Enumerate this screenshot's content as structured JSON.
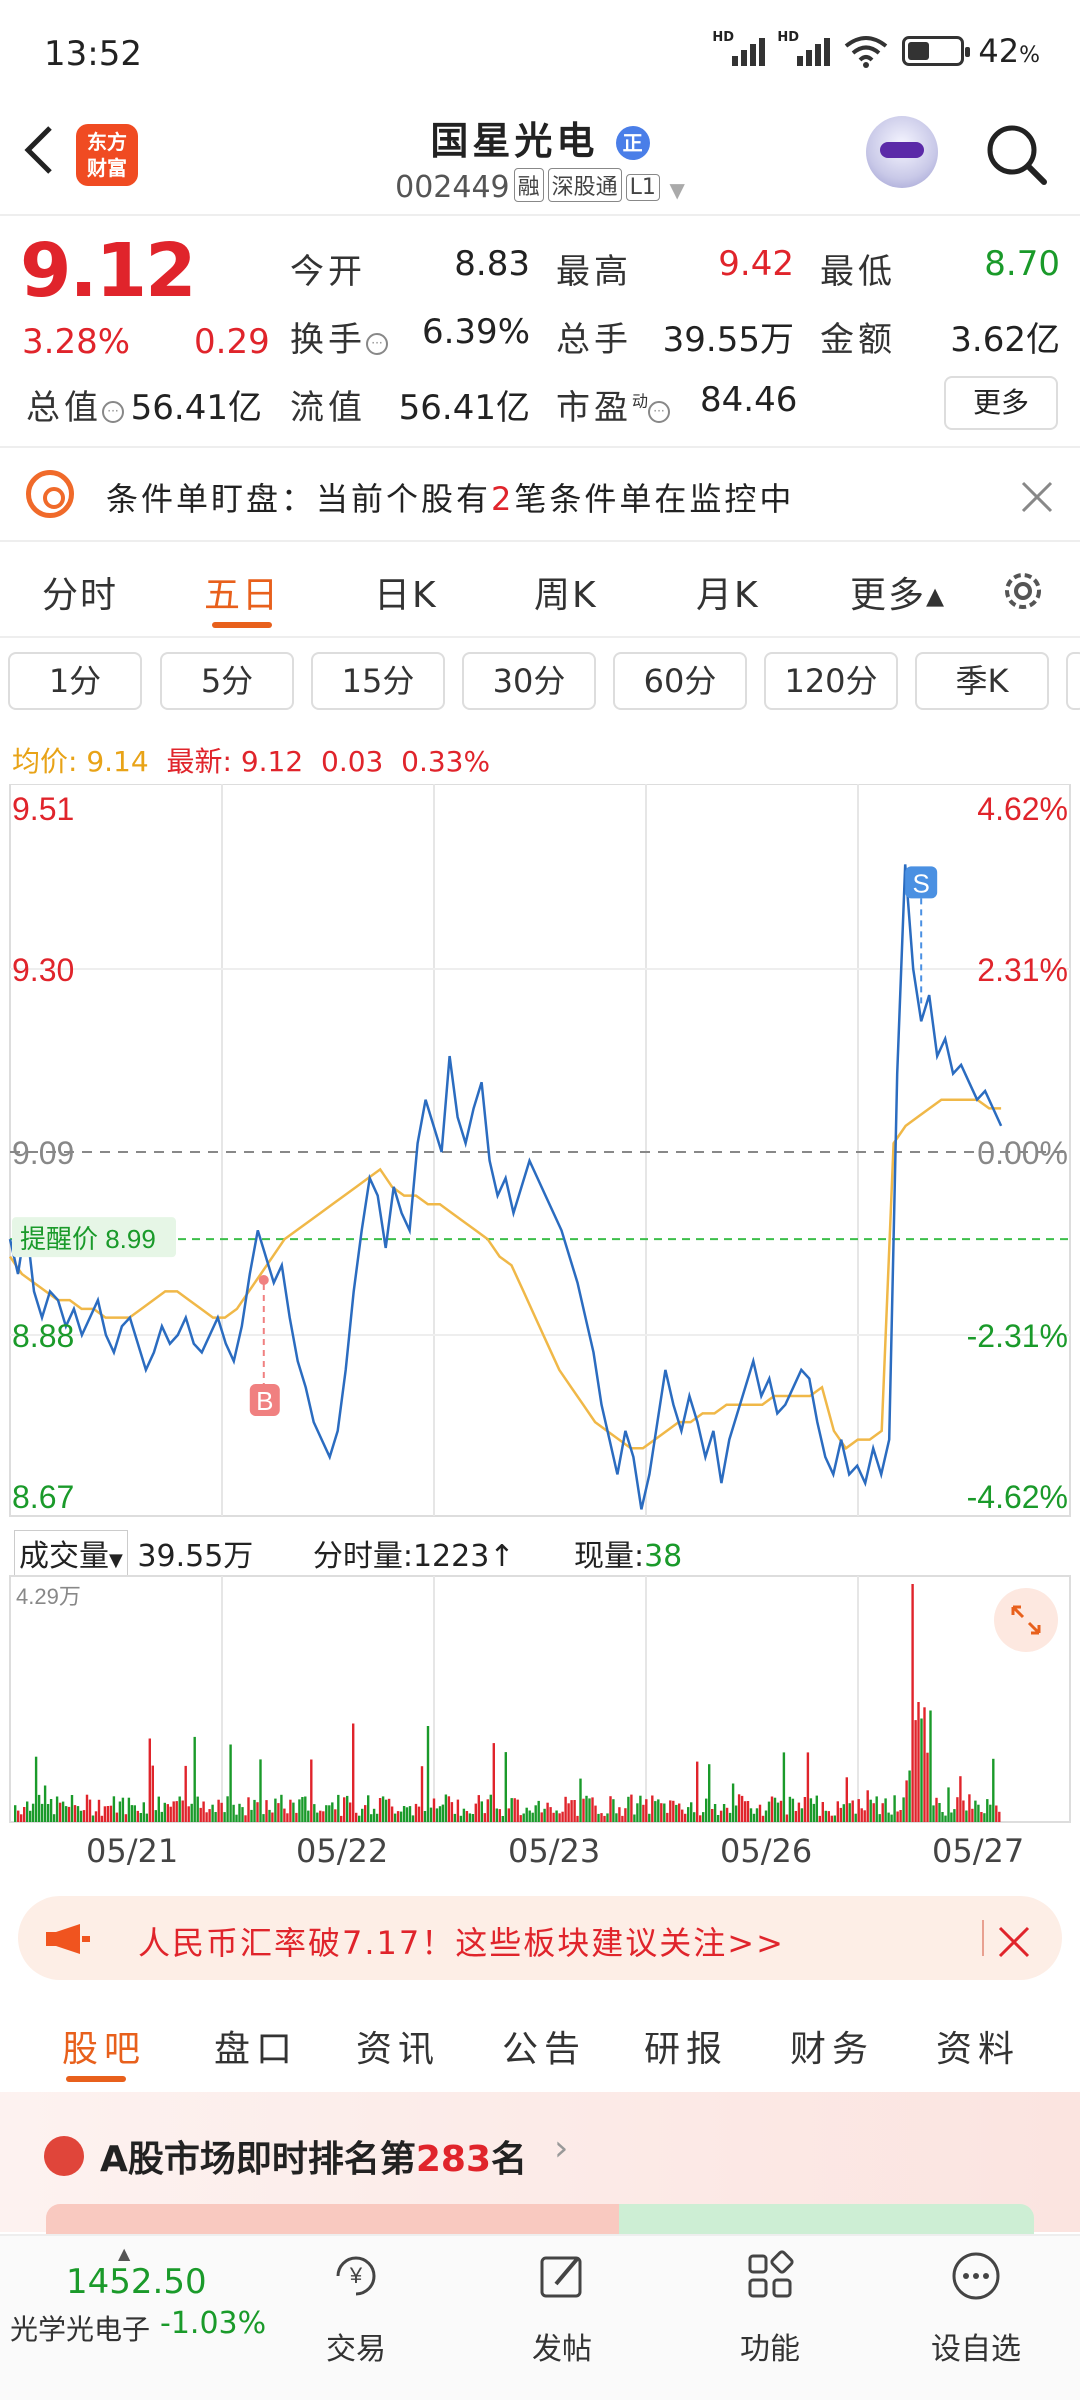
{
  "status_bar": {
    "time": "13:52",
    "signal1": "HD",
    "signal2": "HD",
    "battery": "42",
    "battery_suffix": "%",
    "battery_level": 0.42
  },
  "header": {
    "back_icon": "chevron-left-icon",
    "logo_line1": "东方",
    "logo_line2": "财富",
    "stock_name": "国星光电",
    "badge": "正",
    "code": "002449",
    "tag1": "融",
    "tag2": "深股通",
    "tag3": "L1"
  },
  "quote": {
    "price": "9.12",
    "change_pct": "3.28%",
    "change": "0.29",
    "open_label": "今开",
    "open": "8.83",
    "high_label": "最高",
    "high": "9.42",
    "low_label": "最低",
    "low": "8.70",
    "turnover_label": "换手",
    "turnover": "6.39%",
    "volume_label": "总手",
    "volume": "39.55万",
    "amount_label": "金额",
    "amount": "3.62亿",
    "mktcap_label": "总值",
    "mktcap": "56.41亿",
    "float_label": "流值",
    "float": "56.41亿",
    "pe_label": "市盈",
    "pe_sup": "动",
    "pe": "84.46",
    "more": "更多"
  },
  "alert": {
    "prefix": "条件单盯盘：当前个股有",
    "count": "2",
    "suffix": "笔条件单在监控中"
  },
  "period_tabs": [
    "分时",
    "五日",
    "日K",
    "周K",
    "月K",
    "更多▴"
  ],
  "active_period": "五日",
  "minute_buttons": [
    "1分",
    "5分",
    "15分",
    "30分",
    "60分",
    "120分",
    "季K"
  ],
  "avg_bar": {
    "avg_label": "均价:",
    "avg": "9.14",
    "latest_label": "最新:",
    "latest": "9.12",
    "chg": "0.03",
    "pct": "0.33%"
  },
  "chart_data": {
    "type": "line",
    "title": "",
    "x": [
      "05/21",
      "05/22",
      "05/23",
      "05/26",
      "05/27"
    ],
    "y_left_ticks": [
      "9.51",
      "9.30",
      "9.09",
      "8.88",
      "8.67"
    ],
    "y_right_ticks": [
      "4.62%",
      "2.31%",
      "0.00%",
      "-2.31%",
      "-4.62%"
    ],
    "ylim": [
      8.67,
      9.51
    ],
    "prev_close": 9.09,
    "reminder_label": "提醒价",
    "reminder_price": "8.99",
    "reminder_value": 8.99,
    "buy_marker": "B",
    "sell_marker": "S",
    "series": [
      {
        "values": [
          8.99,
          8.95,
          9.01,
          8.93,
          8.9,
          8.93,
          8.92,
          8.89,
          8.91,
          8.88,
          8.9,
          8.92,
          8.88,
          8.86,
          8.89,
          8.9,
          8.87,
          8.84,
          8.86,
          8.89,
          8.87,
          8.88,
          8.9,
          8.87,
          8.86,
          8.88,
          8.9,
          8.87,
          8.85,
          8.89,
          8.95,
          9.0,
          8.97,
          8.94,
          8.96,
          8.9,
          8.85,
          8.82,
          8.78,
          8.76,
          8.74,
          8.77,
          8.84,
          8.93,
          9.0,
          9.06,
          9.04,
          8.98,
          9.05,
          9.02,
          9.0,
          9.1,
          9.15,
          9.12,
          9.09,
          9.2,
          9.13,
          9.1,
          9.14,
          9.17,
          9.08,
          9.04,
          9.06,
          9.02,
          9.05,
          9.08,
          9.06,
          9.04,
          9.02,
          9.0,
          8.97,
          8.94,
          8.9,
          8.86,
          8.8,
          8.76,
          8.72,
          8.77,
          8.74,
          8.68,
          8.72,
          8.78,
          8.84,
          8.8,
          8.77,
          8.81,
          8.78,
          8.74,
          8.77,
          8.71,
          8.76,
          8.79,
          8.82,
          8.85,
          8.81,
          8.83,
          8.79,
          8.8,
          8.82,
          8.84,
          8.83,
          8.78,
          8.74,
          8.72,
          8.76,
          8.72,
          8.73,
          8.71,
          8.75,
          8.72,
          8.76,
          9.18,
          9.42,
          9.3,
          9.24,
          9.27,
          9.2,
          9.22,
          9.18,
          9.19,
          9.17,
          9.15,
          9.16,
          9.14,
          9.12
        ]
      },
      {
        "values": [
          8.97,
          8.95,
          8.94,
          8.93,
          8.92,
          8.92,
          8.91,
          8.91,
          8.9,
          8.9,
          8.9,
          8.91,
          8.92,
          8.93,
          8.93,
          8.92,
          8.91,
          8.9,
          8.9,
          8.91,
          8.93,
          8.95,
          8.97,
          8.99,
          9.0,
          9.01,
          9.02,
          9.03,
          9.04,
          9.05,
          9.06,
          9.07,
          9.05,
          9.04,
          9.04,
          9.03,
          9.03,
          9.02,
          9.01,
          9.0,
          8.99,
          8.97,
          8.96,
          8.93,
          8.9,
          8.87,
          8.84,
          8.82,
          8.8,
          8.78,
          8.77,
          8.76,
          8.75,
          8.75,
          8.76,
          8.77,
          8.78,
          8.78,
          8.79,
          8.79,
          8.8,
          8.8,
          8.8,
          8.8,
          8.81,
          8.81,
          8.81,
          8.81,
          8.82,
          8.77,
          8.75,
          8.76,
          8.76,
          8.77,
          9.1,
          9.12,
          9.13,
          9.14,
          9.15,
          9.15,
          9.15,
          9.15,
          9.14,
          9.14
        ]
      }
    ]
  },
  "volume": {
    "label": "成交量",
    "total": "39.55万",
    "minute_label": "分时量:",
    "minute": "1223",
    "now_label": "现量:",
    "now": "38",
    "max_tick": "4.29万"
  },
  "banner": {
    "text": "人民币汇率破7.17！这些板块建议关注>>"
  },
  "bottom_tabs": [
    "股吧",
    "盘口",
    "资讯",
    "公告",
    "研报",
    "财务",
    "资料"
  ],
  "active_bottom_tab": "股吧",
  "rank": {
    "prefix": "A股市场即时排名第",
    "num": "283",
    "suffix": "名"
  },
  "bottom_nav": {
    "index_value": "1452.50",
    "index_name": "光学光电子",
    "index_pct": "-1.03%",
    "items": [
      {
        "label": "交易",
        "icon": "yen-trade-icon"
      },
      {
        "label": "发帖",
        "icon": "edit-post-icon"
      },
      {
        "label": "功能",
        "icon": "grid-apps-icon"
      },
      {
        "label": "设自选",
        "icon": "more-dots-icon"
      }
    ]
  }
}
